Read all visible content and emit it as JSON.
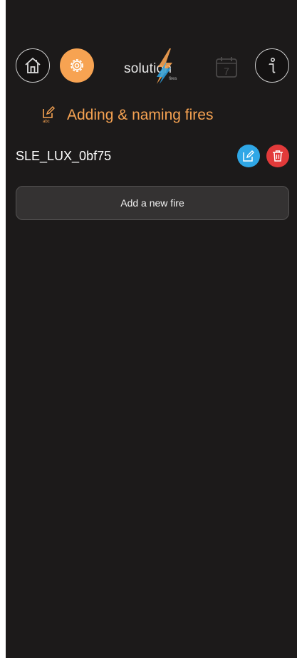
{
  "header": {
    "home_icon": "home-icon",
    "settings_icon": "gear-icon",
    "logo_text": "solution",
    "logo_subtext": "fires",
    "calendar_icon": "calendar-icon",
    "calendar_day": "7",
    "info_icon": "info-icon"
  },
  "section": {
    "icon": "edit-abc-icon",
    "icon_caption": "abc",
    "title": "Adding & naming fires"
  },
  "fires": [
    {
      "name": "SLE_LUX_0bf75"
    }
  ],
  "add_button_label": "Add a new fire",
  "colors": {
    "background": "#1c1a1a",
    "accent": "#f7a352",
    "edit": "#2fa7e6",
    "delete": "#e23a3a",
    "button_bg": "#343232"
  }
}
